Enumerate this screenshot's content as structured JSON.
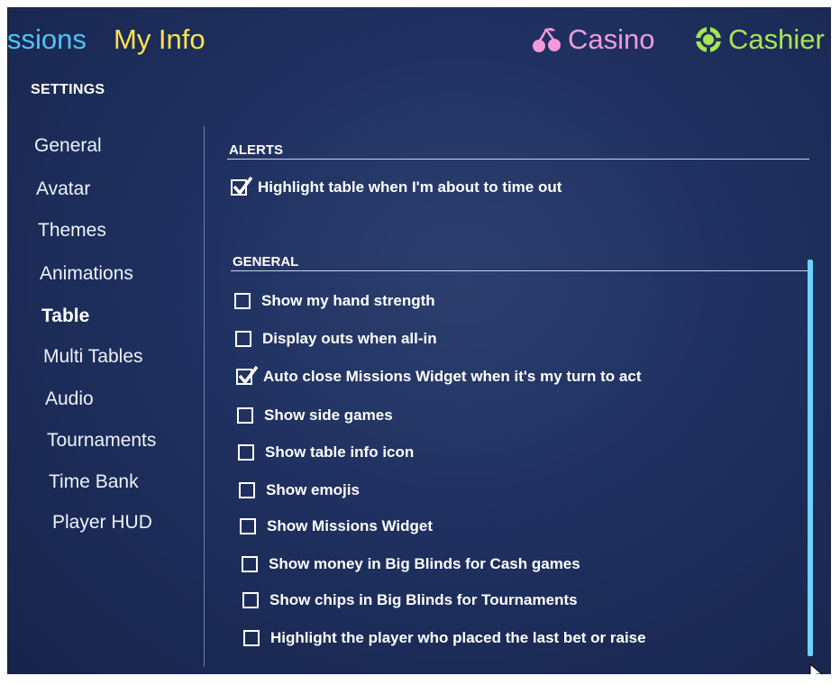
{
  "topnav": {
    "missions_label": "ssions",
    "myinfo_label": "My Info",
    "casino_label": "Casino",
    "casino_icon": "cherries-icon",
    "cashier_label": "Cashier",
    "cashier_icon": "chip-icon"
  },
  "settings": {
    "title": "SETTINGS"
  },
  "sidebar": {
    "items": [
      {
        "label": "General"
      },
      {
        "label": "Avatar"
      },
      {
        "label": "Themes"
      },
      {
        "label": "Animations"
      },
      {
        "label": "Table",
        "active": true
      },
      {
        "label": "Multi Tables"
      },
      {
        "label": "Audio"
      },
      {
        "label": "Tournaments"
      },
      {
        "label": "Time Bank"
      },
      {
        "label": "Player HUD"
      }
    ]
  },
  "alerts": {
    "title": "ALERTS",
    "options": [
      {
        "label": "Highlight table when I'm about to time out",
        "checked": true
      }
    ]
  },
  "general": {
    "title": "GENERAL",
    "options": [
      {
        "label": "Show my hand strength",
        "checked": false
      },
      {
        "label": "Display outs when all-in",
        "checked": false
      },
      {
        "label": "Auto close Missions Widget when it's my turn to act",
        "checked": true
      },
      {
        "label": "Show side games",
        "checked": false
      },
      {
        "label": "Show table info icon",
        "checked": false
      },
      {
        "label": "Show emojis",
        "checked": false
      },
      {
        "label": "Show Missions Widget",
        "checked": false
      },
      {
        "label": "Show money in Big Blinds for Cash games",
        "checked": false
      },
      {
        "label": "Show chips in Big Blinds for Tournaments",
        "checked": false
      },
      {
        "label": "Highlight the player who placed the last bet or raise",
        "checked": false
      }
    ]
  },
  "colors": {
    "background": "#1f3060",
    "missions": "#4fc3f7",
    "myinfo": "#ffe14d",
    "casino": "#f29bd8",
    "cashier": "#a6e653",
    "scrollbar": "#6fd1ff"
  }
}
